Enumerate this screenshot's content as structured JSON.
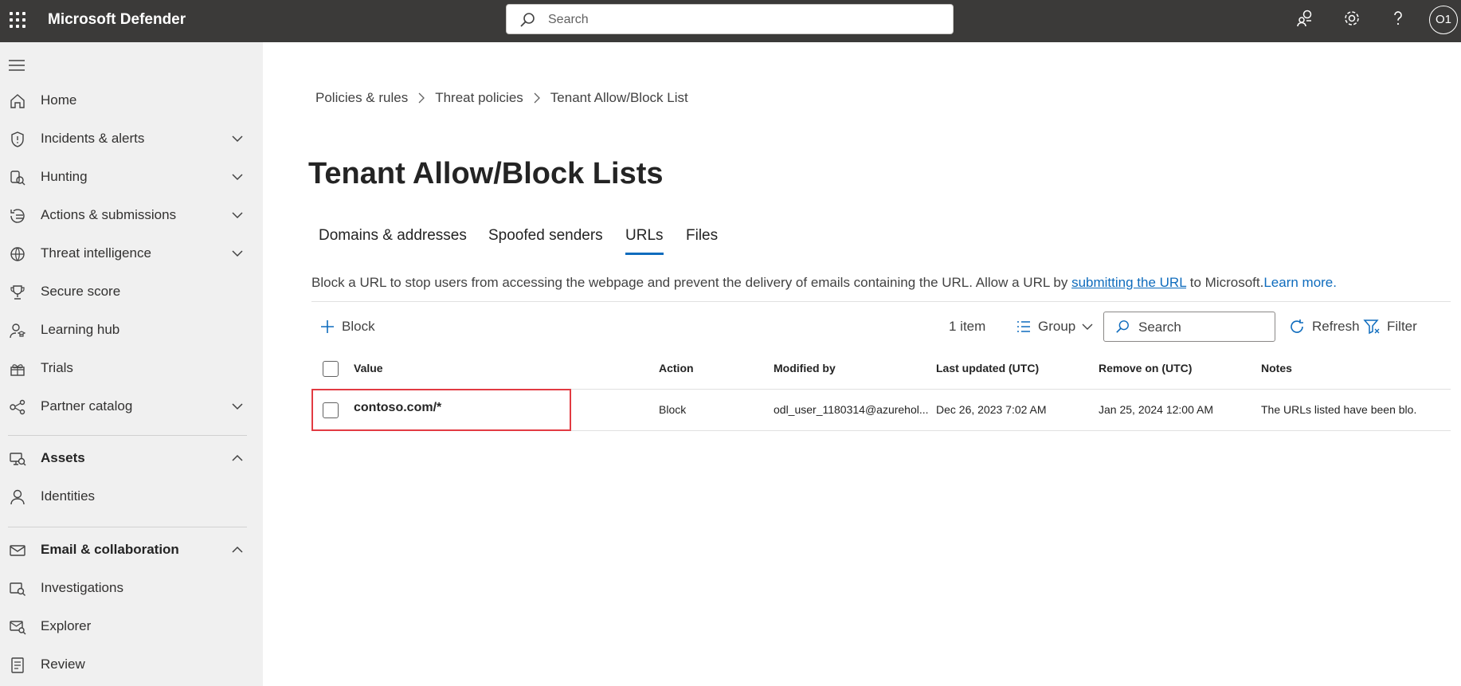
{
  "app": {
    "title": "Microsoft Defender",
    "avatar_initials": "O1",
    "accent": "#0f6cbd",
    "topbar_bg": "#3b3a39"
  },
  "top_search": {
    "placeholder": "Search"
  },
  "sidebar": {
    "items": [
      {
        "label": "Home",
        "icon": "home-icon",
        "chevron": ""
      },
      {
        "label": "Incidents & alerts",
        "icon": "shield-icon",
        "chevron": "down"
      },
      {
        "label": "Hunting",
        "icon": "hunting-icon",
        "chevron": "down"
      },
      {
        "label": "Actions & submissions",
        "icon": "actions-icon",
        "chevron": "down"
      },
      {
        "label": "Threat intelligence",
        "icon": "threat-intel-icon",
        "chevron": "down"
      },
      {
        "label": "Secure score",
        "icon": "trophy-icon",
        "chevron": ""
      },
      {
        "label": "Learning hub",
        "icon": "learning-icon",
        "chevron": ""
      },
      {
        "label": "Trials",
        "icon": "trials-icon",
        "chevron": ""
      },
      {
        "label": "Partner catalog",
        "icon": "partner-icon",
        "chevron": "down"
      },
      {
        "label": "Assets",
        "icon": "assets-icon",
        "chevron": "up"
      },
      {
        "label": "Identities",
        "icon": "person-icon",
        "chevron": ""
      },
      {
        "label": "Email & collaboration",
        "icon": "mail-icon",
        "chevron": "up"
      },
      {
        "label": "Investigations",
        "icon": "investigations-icon",
        "chevron": ""
      },
      {
        "label": "Explorer",
        "icon": "explorer-icon",
        "chevron": ""
      },
      {
        "label": "Review",
        "icon": "review-icon",
        "chevron": ""
      }
    ]
  },
  "breadcrumb": [
    "Policies & rules",
    "Threat policies",
    "Tenant Allow/Block List"
  ],
  "page_title": "Tenant Allow/Block Lists",
  "tabs": [
    {
      "label": "Domains & addresses",
      "active": false
    },
    {
      "label": "Spoofed senders",
      "active": false
    },
    {
      "label": "URLs",
      "active": true
    },
    {
      "label": "Files",
      "active": false
    }
  ],
  "description": {
    "text": "Block a URL to stop users from accessing the webpage and prevent the delivery of emails containing the URL. Allow a URL by ",
    "link1": "submitting the URL",
    "text2": " to Microsoft.",
    "link2": "Learn more."
  },
  "toolbar": {
    "block_label": "Block",
    "count_label": "1 item",
    "group_label": "Group",
    "search_placeholder": "Search",
    "refresh_label": "Refresh",
    "filter_label": "Filter"
  },
  "table": {
    "columns": [
      "Value",
      "Action",
      "Modified by",
      "Last updated (UTC)",
      "Remove on (UTC)",
      "Notes"
    ],
    "rows": [
      {
        "value": "contoso.com/*",
        "action": "Block",
        "modified_by": "odl_user_1180314@azurehol...",
        "last_updated": "Dec 26, 2023 7:02 AM",
        "remove_on": "Jan 25, 2024 12:00 AM",
        "notes": "The URLs listed have been blo..."
      }
    ]
  },
  "highlight_color": "#e23b42"
}
